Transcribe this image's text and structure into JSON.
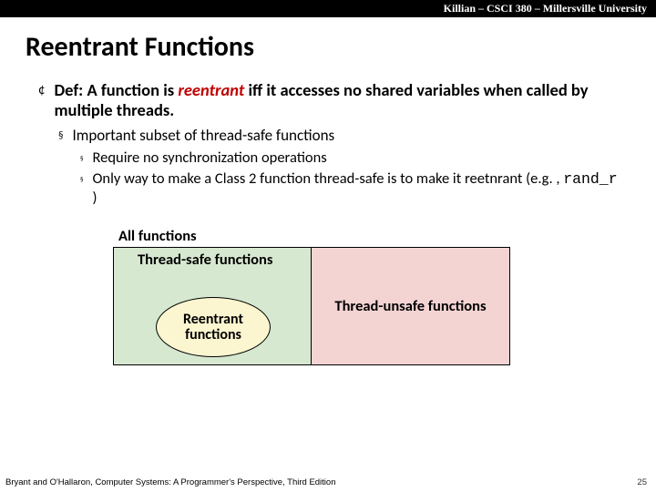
{
  "header": {
    "text": "Killian – CSCI 380 – Millersville University"
  },
  "title": "Reentrant Functions",
  "def": {
    "prefix": "Def: A function is ",
    "word": "reentrant",
    "suffix": " iff it accesses no shared variables when called by multiple threads."
  },
  "sub1": "Important subset of thread-safe functions",
  "sub1a": "Require no synchronization operations",
  "sub1b_prefix": "Only way to make a Class 2 function thread-safe is to make it reetnrant (e.g. , ",
  "sub1b_code": "rand_r",
  "sub1b_suffix": " )",
  "diagram": {
    "all": "All functions",
    "threadsafe": "Thread-safe functions",
    "reentrant": "Reentrant functions",
    "unsafe": "Thread-unsafe functions"
  },
  "footer": {
    "attribution": "Bryant and O'Hallaron, Computer Systems: A Programmer's Perspective, Third Edition",
    "page": "25"
  }
}
